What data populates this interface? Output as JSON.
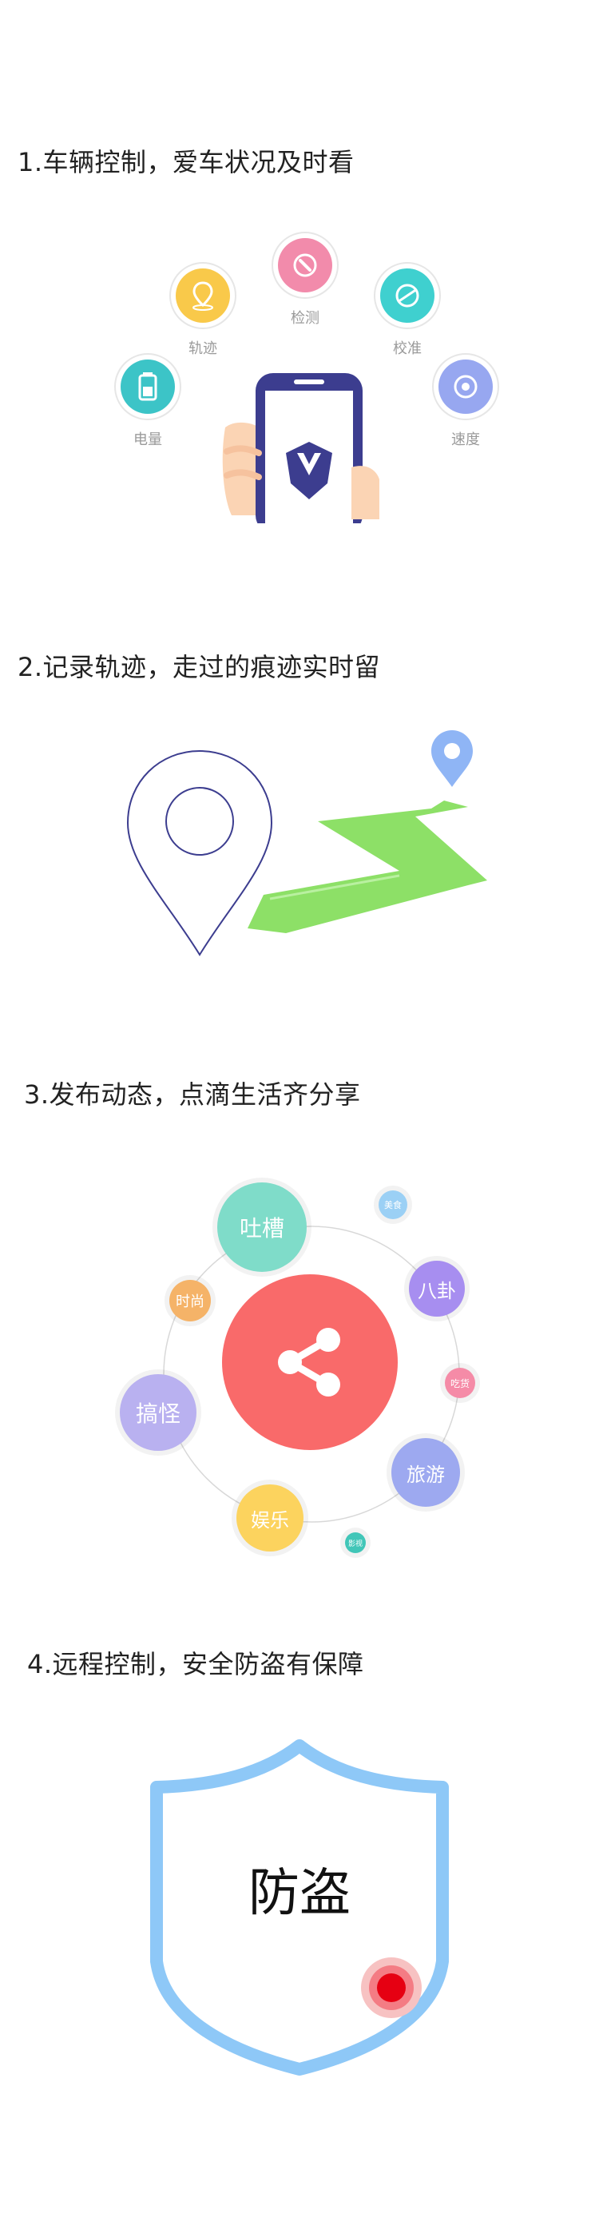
{
  "sections": [
    {
      "title": "1.车辆控制，爱车状况及时看"
    },
    {
      "title": "2.记录轨迹，走过的痕迹实时留"
    },
    {
      "title": "3.发布动态，点滴生活齐分享"
    },
    {
      "title": "4.远程控制，安全防盗有保障"
    }
  ],
  "features": {
    "battery": {
      "label": "电量",
      "color": "#3cc4c7",
      "icon": "battery-icon"
    },
    "track": {
      "label": "轨迹",
      "color": "#f9c94a",
      "icon": "map-pin-icon"
    },
    "detect": {
      "label": "检测",
      "color": "#f28bab",
      "icon": "wrench-icon"
    },
    "calibrate": {
      "label": "校准",
      "color": "#3fd0cf",
      "icon": "compass-icon"
    },
    "speed": {
      "label": "速度",
      "color": "#97a7f0",
      "icon": "gauge-icon"
    }
  },
  "social": {
    "tucao": "吐槽",
    "shishang": "时尚",
    "gaoguai": "搞怪",
    "yule": "娱乐",
    "bagua": "八卦",
    "lvyou": "旅游",
    "meishi": "美食",
    "chihuo": "吃货",
    "yingshi": "影视",
    "share_color": "#f96a6a"
  },
  "antitheft": {
    "label": "防盗",
    "shield_color": "#8ec8f7",
    "dot_color": "#e60012"
  }
}
